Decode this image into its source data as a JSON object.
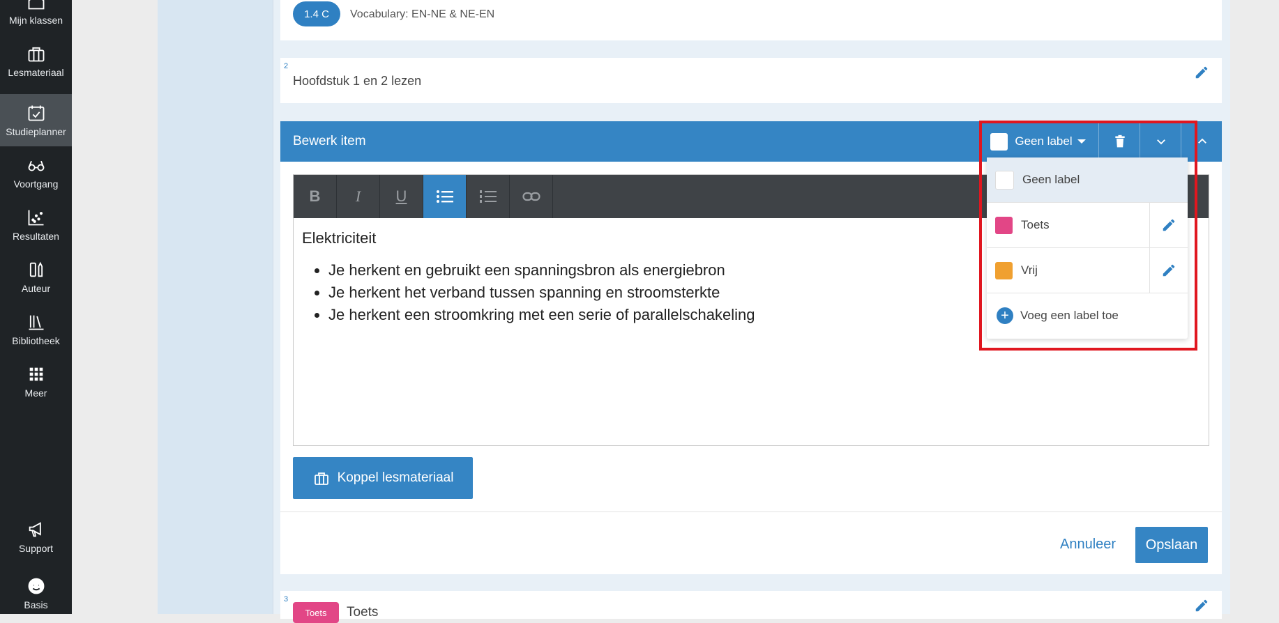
{
  "nav": {
    "items": [
      {
        "label": "Mijn klassen",
        "icon": "home-icon"
      },
      {
        "label": "Lesmateriaal",
        "icon": "briefcase-icon"
      },
      {
        "label": "Studieplanner",
        "icon": "calendar-check-icon",
        "active": true
      },
      {
        "label": "Voortgang",
        "icon": "glasses-icon"
      },
      {
        "label": "Resultaten",
        "icon": "scatter-chart-icon"
      },
      {
        "label": "Auteur",
        "icon": "author-icon"
      },
      {
        "label": "Bibliotheek",
        "icon": "library-icon"
      },
      {
        "label": "Meer",
        "icon": "grid-icon"
      }
    ],
    "bottom": [
      {
        "label": "Support",
        "icon": "megaphone-icon"
      },
      {
        "label": "Basis",
        "icon": "avatar-icon"
      }
    ]
  },
  "items": {
    "first": {
      "badge": "1.4 C",
      "text": "Vocabulary: EN-NE & NE-EN"
    },
    "second": {
      "number": "2",
      "text": "Hoofdstuk 1 en 2 lezen"
    },
    "third": {
      "number": "3",
      "tag": "Toets",
      "text": "Toets"
    }
  },
  "edit": {
    "title": "Bewerk item",
    "label_select": "Geen label",
    "content_heading": "Elektriciteit",
    "bullets": [
      "Je herkent en gebruikt een spanningsbron als energiebron",
      "Je herkent het verband tussen spanning en stroomsterkte",
      "Je herkent een stroomkring met een serie of parallelschakeling"
    ],
    "toolbar": [
      "B",
      "I",
      "U"
    ],
    "koppel_label": "Koppel lesmateriaal",
    "cancel_label": "Annuleer",
    "save_label": "Opslaan"
  },
  "dropdown": {
    "options": [
      {
        "label": "Geen label",
        "color": "#ffffff"
      },
      {
        "label": "Toets",
        "color": "#e24686"
      },
      {
        "label": "Vrij",
        "color": "#f0a030"
      }
    ],
    "add_label": "Voeg een label toe"
  },
  "colors": {
    "accent": "#3585c4",
    "highlight": "#e0161f",
    "sidebar": "#1f2326"
  }
}
